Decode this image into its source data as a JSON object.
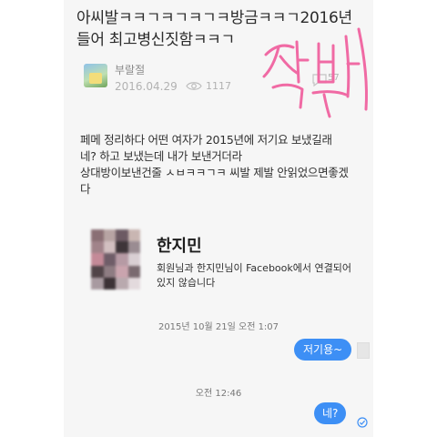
{
  "post": {
    "title_line1": "아씨발ㅋㅋㄱㅋㄱㅋㄱㅋ방금ㅋㅋㄱ2016년",
    "title_line2": "들어 최고병신짓함ㅋㅋㄱ",
    "author": "부랄절",
    "date": "2016.04.29",
    "views": "1117",
    "comments": "57",
    "body_lines": [
      "페메 정리하다 어떤 여자가 2015년에 저기요 보냈길래",
      "네? 하고 보냈는데 내가 보낸거더라",
      "상대방이보낸건줄 ㅅㅂㅋㅋㄱㅋ 씨발 제발 안읽었으면좋겠",
      "다"
    ]
  },
  "overlay": {
    "signature_text": "작뽀"
  },
  "messenger": {
    "contact_name": "한지민",
    "fb_notice_line1": "회원님과 한지민님이 Facebook에서 연결되어",
    "fb_notice_line2": "있지 않습니다",
    "time_1": "2015년 10월 21일 오전 1:07",
    "message_1": "저기용~",
    "time_2": "오전 12:46",
    "message_2": "네?"
  },
  "colors": {
    "bubble": "#3d8ff5",
    "signature_pink": "#f06aa4",
    "background": "#f6f6f6"
  },
  "icons": [
    "eye-icon",
    "comment-icon",
    "seen-check-icon"
  ]
}
